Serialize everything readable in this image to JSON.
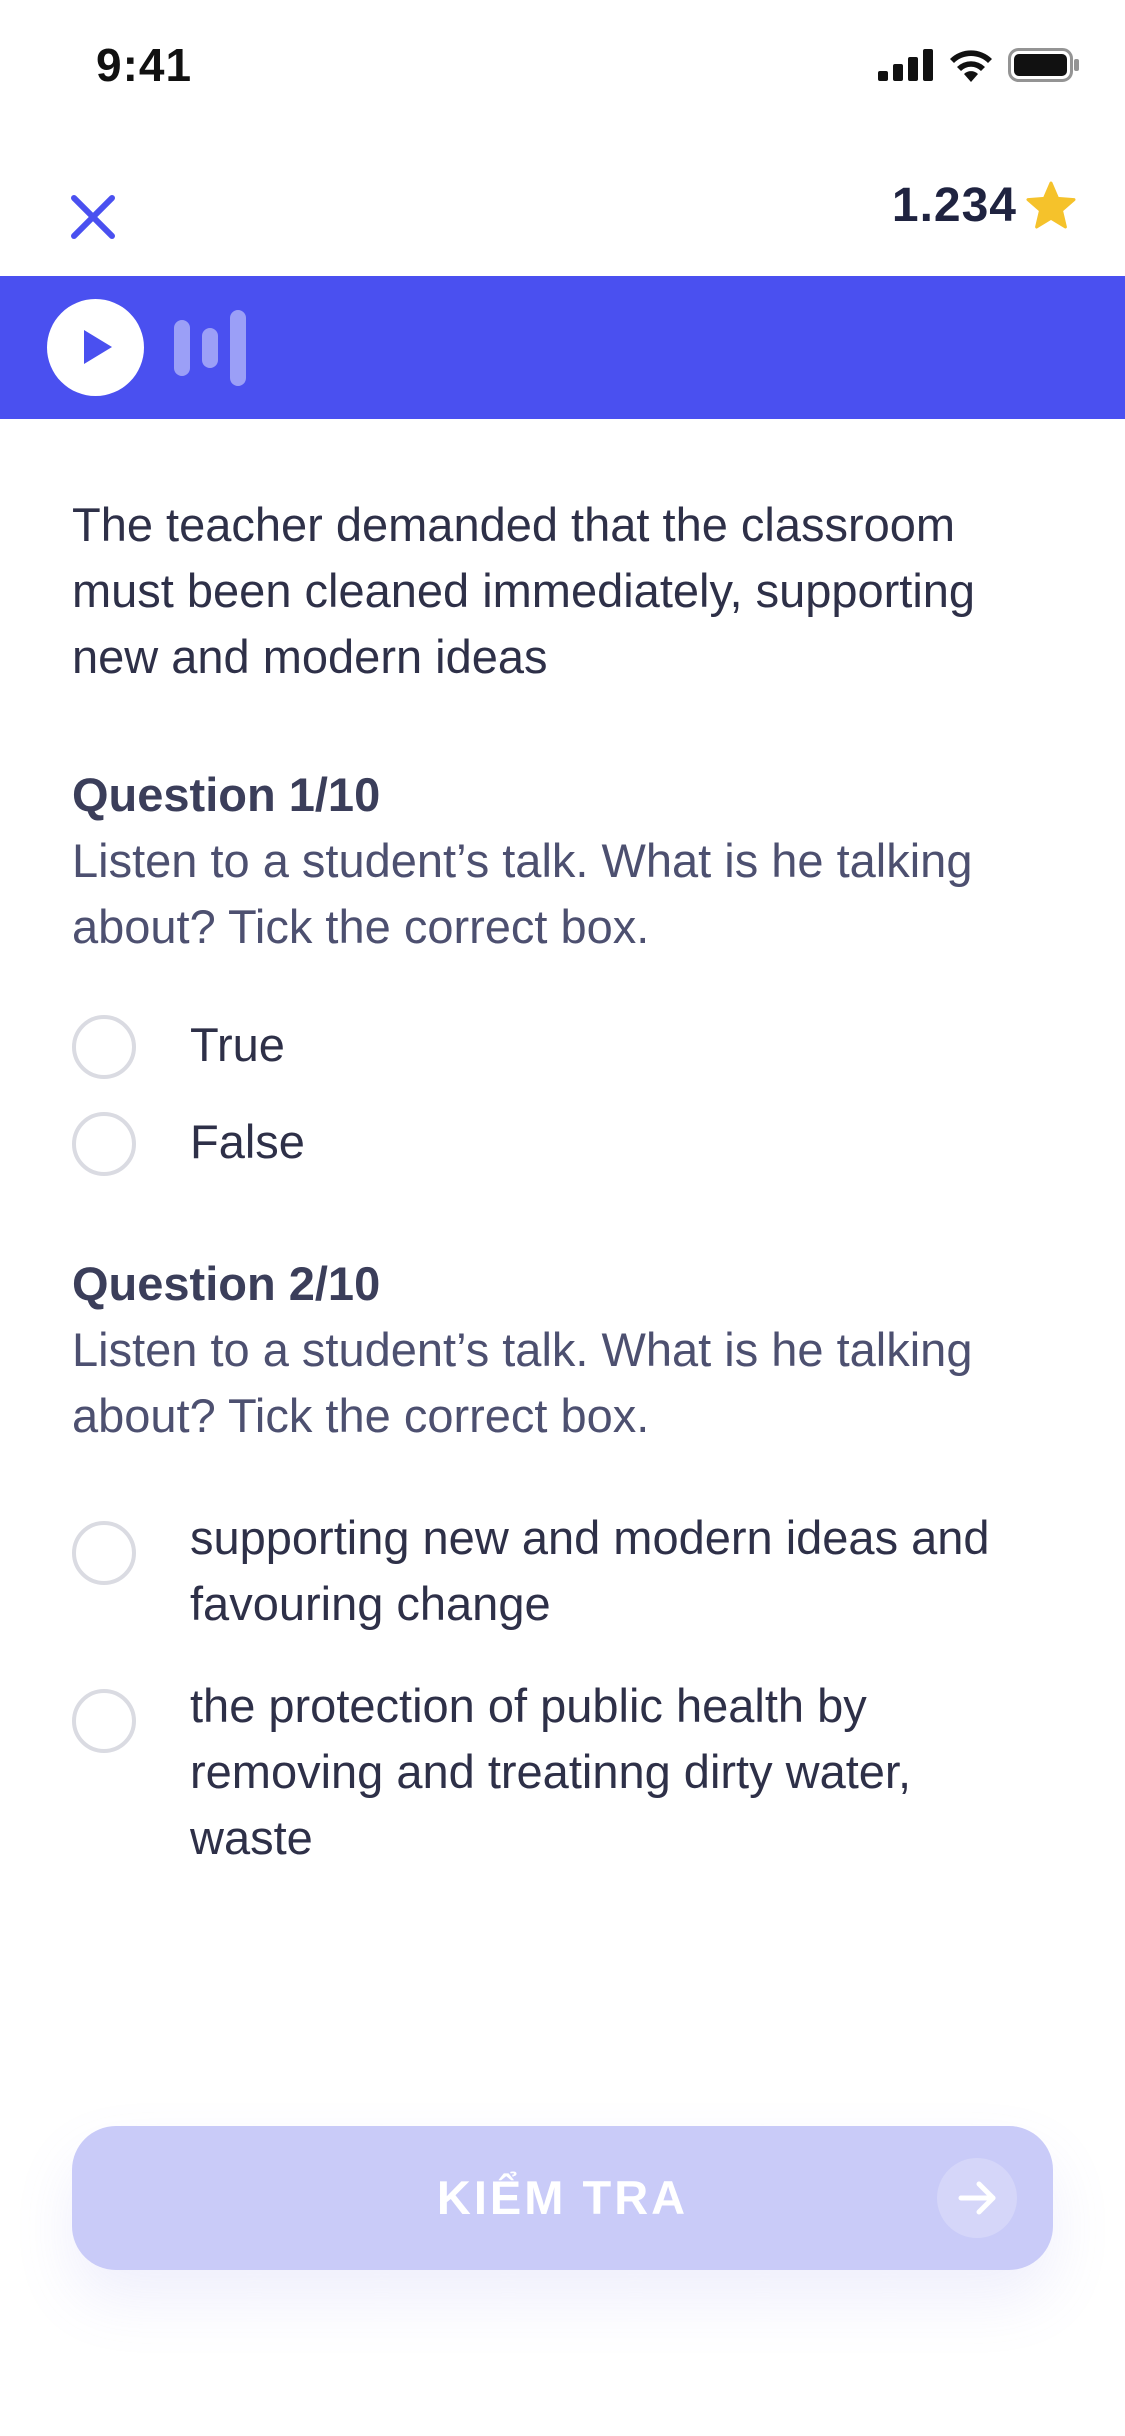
{
  "status_bar": {
    "time": "9:41"
  },
  "header": {
    "score": "1.234"
  },
  "passage": "The teacher demanded that the classroom must been cleaned immediately, supporting new and modern ideas",
  "questions": [
    {
      "title": "Question 1/10",
      "text": "Listen to a student’s talk. What is he talking about? Tick the correct box.",
      "options": [
        "True",
        "False"
      ]
    },
    {
      "title": "Question 2/10",
      "text": "Listen to a student’s talk. What is he talking about? Tick the correct box.",
      "options": [
        "supporting new and modern ideas and favouring change",
        "the protection of public health by removing and treatinng dirty water, waste"
      ]
    }
  ],
  "check_button": {
    "label": "KIỂM TRA"
  },
  "colors": {
    "accent": "#4a50f0",
    "button_disabled": "#c9cbf8",
    "star": "#f5c22b"
  },
  "icons": {
    "close": "close-icon",
    "star": "star-icon",
    "play": "play-icon",
    "arrow": "arrow-right-icon",
    "signal": "cellular-signal-icon",
    "wifi": "wifi-icon",
    "battery": "battery-icon"
  }
}
